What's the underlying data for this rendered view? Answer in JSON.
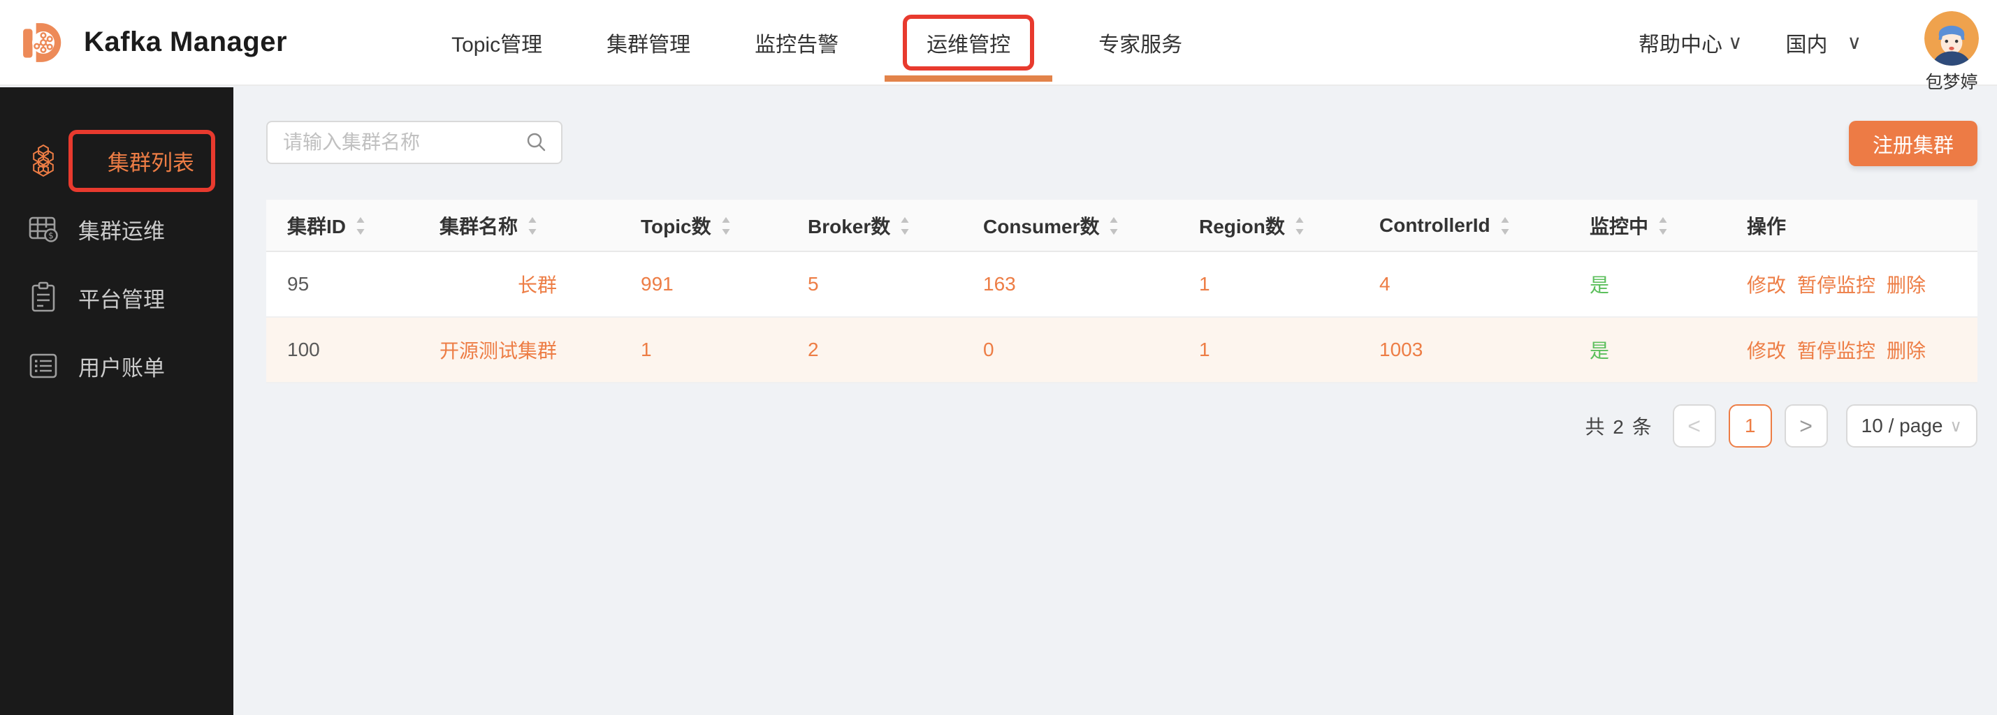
{
  "header": {
    "title": "Kafka Manager",
    "nav": [
      {
        "label": "Topic管理",
        "active": false
      },
      {
        "label": "集群管理",
        "active": false
      },
      {
        "label": "监控告警",
        "active": false
      },
      {
        "label": "运维管控",
        "active": true
      },
      {
        "label": "专家服务",
        "active": false
      }
    ],
    "help_label": "帮助中心",
    "region_label": "国内",
    "username": "包梦婷"
  },
  "sidebar": {
    "items": [
      {
        "label": "集群列表",
        "icon": "honeycomb-icon",
        "active": true
      },
      {
        "label": "集群运维",
        "icon": "table-coin-icon",
        "active": false
      },
      {
        "label": "平台管理",
        "icon": "clipboard-icon",
        "active": false
      },
      {
        "label": "用户账单",
        "icon": "list-icon",
        "active": false
      }
    ]
  },
  "toolbar": {
    "search_placeholder": "请输入集群名称",
    "register_label": "注册集群"
  },
  "table": {
    "columns": [
      {
        "label": "集群ID",
        "sortable": true
      },
      {
        "label": "集群名称",
        "sortable": true
      },
      {
        "label": "Topic数",
        "sortable": true
      },
      {
        "label": "Broker数",
        "sortable": true
      },
      {
        "label": "Consumer数",
        "sortable": true
      },
      {
        "label": "Region数",
        "sortable": true
      },
      {
        "label": "ControllerId",
        "sortable": true
      },
      {
        "label": "监控中",
        "sortable": true
      },
      {
        "label": "操作",
        "sortable": false
      }
    ],
    "rows": [
      {
        "id": "95",
        "name": "长群",
        "topics": "991",
        "brokers": "5",
        "consumers": "163",
        "regions": "1",
        "controller_id": "4",
        "monitoring": "是",
        "actions": {
          "edit": "修改",
          "pause": "暂停监控",
          "delete": "删除"
        }
      },
      {
        "id": "100",
        "name": "开源测试集群",
        "topics": "1",
        "brokers": "2",
        "consumers": "0",
        "regions": "1",
        "controller_id": "1003",
        "monitoring": "是",
        "actions": {
          "edit": "修改",
          "pause": "暂停监控",
          "delete": "删除"
        }
      }
    ]
  },
  "pagination": {
    "total_text": "共 2 条",
    "current_page": "1",
    "page_size_label": "10 / page"
  },
  "icons": {
    "chevron_down": "∨",
    "sort_asc": "▲",
    "sort_desc": "▼",
    "prev": "<",
    "next": ">"
  },
  "colors": {
    "accent_orange": "#ED7D45",
    "button_orange": "#ED7B45",
    "underline_orange": "#E2834A",
    "annotation_red": "#E83A2E",
    "monitoring_green": "#5CBF5C",
    "sidebar_bg": "#1A1A1A",
    "page_bg": "#F0F2F5",
    "row_highlight": "#FDF5EE",
    "table_head_bg": "#FAFAFA"
  }
}
